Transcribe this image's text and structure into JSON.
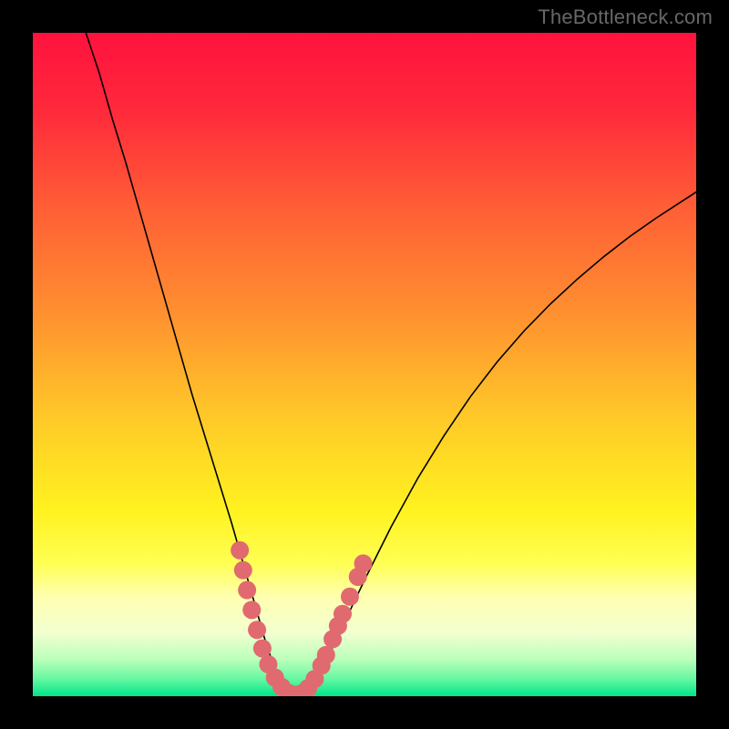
{
  "watermark": "TheBottleneck.com",
  "chart_data": {
    "type": "line",
    "title": "",
    "xlabel": "",
    "ylabel": "",
    "xlim": [
      0,
      100
    ],
    "ylim": [
      0,
      100
    ],
    "grid": false,
    "legend": false,
    "background_gradient_stops": [
      {
        "offset": 0.0,
        "color": "#ff123e"
      },
      {
        "offset": 0.12,
        "color": "#ff2a3b"
      },
      {
        "offset": 0.26,
        "color": "#ff5d36"
      },
      {
        "offset": 0.42,
        "color": "#ff8f30"
      },
      {
        "offset": 0.58,
        "color": "#ffc928"
      },
      {
        "offset": 0.72,
        "color": "#fff21f"
      },
      {
        "offset": 0.8,
        "color": "#ffff54"
      },
      {
        "offset": 0.85,
        "color": "#ffffb0"
      },
      {
        "offset": 0.905,
        "color": "#f2ffd0"
      },
      {
        "offset": 0.945,
        "color": "#baffba"
      },
      {
        "offset": 0.975,
        "color": "#62f7a0"
      },
      {
        "offset": 1.0,
        "color": "#00e58a"
      }
    ],
    "series": [
      {
        "name": "bottleneck-curve",
        "color": "#000000",
        "width": 1.6,
        "x": [
          8,
          10,
          12,
          14,
          16,
          18,
          20,
          22,
          24,
          26,
          28,
          30,
          32,
          33,
          34,
          35,
          36,
          37,
          38,
          39,
          40,
          41,
          42,
          44,
          46,
          48,
          50,
          54,
          58,
          62,
          66,
          70,
          74,
          78,
          82,
          86,
          90,
          94,
          98,
          100
        ],
        "y": [
          100,
          94,
          87,
          80.5,
          73.5,
          66.5,
          59.5,
          52.5,
          45.5,
          39,
          32.5,
          26,
          19,
          15.5,
          12,
          8.5,
          5.5,
          3.2,
          1.6,
          0.6,
          0.2,
          0.6,
          1.7,
          5.0,
          9.0,
          13.3,
          17.5,
          25.5,
          32.8,
          39.3,
          45.2,
          50.4,
          55.0,
          59.1,
          62.8,
          66.2,
          69.3,
          72.1,
          74.7,
          76.0
        ]
      },
      {
        "name": "marker-cluster",
        "color": "#e06a6f",
        "type": "scatter",
        "marker_size": 10,
        "x": [
          31.2,
          31.7,
          32.3,
          33.0,
          33.8,
          34.6,
          35.5,
          36.5,
          37.5,
          38.5,
          39.5,
          40.5,
          41.5,
          42.5,
          43.5,
          44.2,
          45.2,
          46.0,
          46.7,
          47.8,
          49.0,
          49.8
        ],
        "y": [
          22.0,
          19.0,
          16.0,
          13.0,
          10.0,
          7.2,
          4.8,
          2.8,
          1.4,
          0.5,
          0.2,
          0.4,
          1.2,
          2.6,
          4.6,
          6.2,
          8.6,
          10.6,
          12.4,
          15.0,
          18.0,
          20.0
        ]
      }
    ]
  }
}
